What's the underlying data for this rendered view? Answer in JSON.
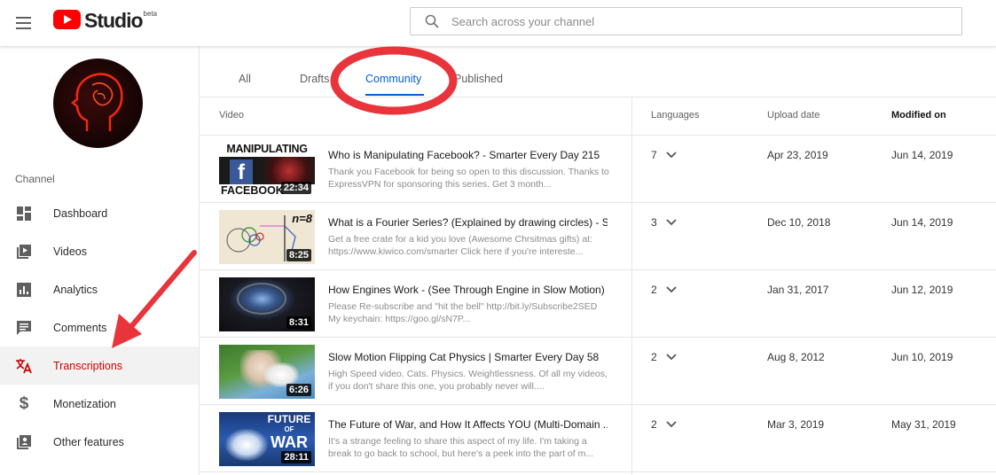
{
  "app": {
    "logo_text": "Studio",
    "logo_badge": "beta"
  },
  "search": {
    "placeholder": "Search across your channel"
  },
  "sidebar": {
    "section_label": "Channel",
    "items": [
      {
        "label": "Dashboard",
        "icon": "dashboard-icon"
      },
      {
        "label": "Videos",
        "icon": "videos-icon"
      },
      {
        "label": "Analytics",
        "icon": "analytics-icon"
      },
      {
        "label": "Comments",
        "icon": "comments-icon"
      },
      {
        "label": "Transcriptions",
        "icon": "translate-icon",
        "active": true
      },
      {
        "label": "Monetization",
        "icon": "dollar-icon"
      },
      {
        "label": "Other features",
        "icon": "other-features-icon"
      }
    ]
  },
  "tabs": [
    {
      "label": "All"
    },
    {
      "label": "Drafts"
    },
    {
      "label": "Community",
      "active": true
    },
    {
      "label": "Published"
    }
  ],
  "table": {
    "headers": {
      "video": "Video",
      "languages": "Languages",
      "upload_date": "Upload date",
      "modified_on": "Modified on"
    },
    "rows": [
      {
        "title": "Who is Manipulating Facebook? - Smarter Every Day 215",
        "description": "Thank you Facebook for being so open to this discussion. Thanks to ExpressVPN for sponsoring this series. Get 3 month...",
        "duration": "22:34",
        "thumb_text_top": "MANIPULATING",
        "thumb_text_bottom": "FACEBOOK",
        "languages": "7",
        "upload_date": "Apr 23, 2019",
        "modified_on": "Jun 14, 2019"
      },
      {
        "title": "What is a Fourier Series? (Explained by drawing circles) - S...",
        "description": "Get a free crate for a kid you love (Awesome Chrsitmas gifts) at: https://www.kiwico.com/smarter Click here if you're intereste...",
        "duration": "8:25",
        "thumb_text_top": "n=8",
        "languages": "3",
        "upload_date": "Dec 10, 2018",
        "modified_on": "Jun 14, 2019"
      },
      {
        "title": "How Engines Work - (See Through Engine in Slow Motion) -...",
        "description": "Please Re-subscribe and \"hit the bell\" http://bit.ly/Subscribe2SED My keychain: https://goo.gl/sN7P...",
        "duration": "8:31",
        "languages": "2",
        "upload_date": "Jan 31, 2017",
        "modified_on": "Jun 12, 2019"
      },
      {
        "title": "Slow Motion Flipping Cat Physics | Smarter Every Day 58",
        "description": "High Speed video. Cats. Physics. Weightlessness. Of all my videos, if you don't share this one, you probably never will....",
        "duration": "6:26",
        "languages": "2",
        "upload_date": "Aug 8, 2012",
        "modified_on": "Jun 10, 2019"
      },
      {
        "title": "The Future of War, and How It Affects YOU (Multi-Domain ...",
        "description": "It's a strange feeling to share this aspect of my life. I'm taking a break to go back to school, but here's a peek into the part of m...",
        "duration": "28:11",
        "thumb_text_top": "FUTURE",
        "thumb_text_mid": "OF",
        "thumb_text_bottom": "WAR",
        "languages": "2",
        "upload_date": "Mar 3, 2019",
        "modified_on": "May 31, 2019"
      }
    ]
  },
  "colors": {
    "accent_red": "#e8343a",
    "active_tab": "#065fd4",
    "active_nav": "#cc0000"
  }
}
